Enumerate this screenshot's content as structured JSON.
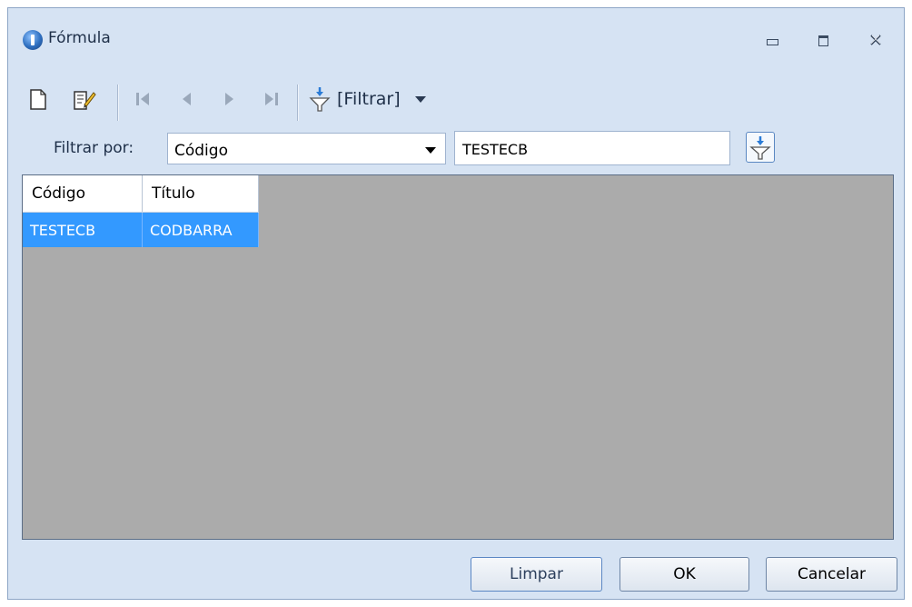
{
  "window": {
    "title": "Fórmula"
  },
  "toolbar": {
    "filter_label": "[Filtrar]"
  },
  "filter": {
    "label": "Filtrar por:",
    "field_selected": "Código",
    "search_value": "TESTECB"
  },
  "grid": {
    "columns": [
      "Código",
      "Título"
    ],
    "rows": [
      {
        "codigo": "TESTECB",
        "titulo": "CODBARRA",
        "selected": true
      }
    ]
  },
  "buttons": {
    "clear": "Limpar",
    "ok": "OK",
    "cancel": "Cancelar"
  },
  "colors": {
    "selection": "#3399ff",
    "grid_background": "#ababab",
    "window_background": "#d6e3f3"
  }
}
